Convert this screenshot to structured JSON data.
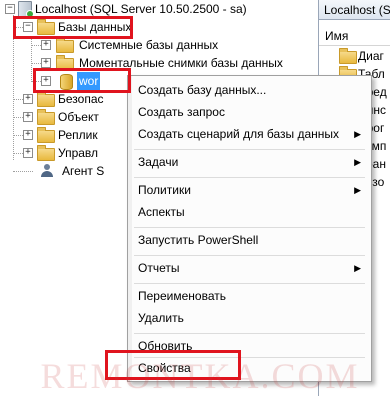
{
  "tree": {
    "server": "Localhost (SQL Server 10.50.2500 - sa)",
    "databases": "Базы данных",
    "system_databases": "Системные базы данных",
    "snapshots": "Моментальные снимки базы данных",
    "selected_db": "wor",
    "security": "Безопас",
    "server_objects": "Объект",
    "replication": "Реплик",
    "management": "Управл",
    "agent": "Агент S"
  },
  "right_panel": {
    "tab": "Localhost (SQL",
    "column_header": "Имя",
    "rows": [
      "Диаг",
      "Табл",
      "Пред",
      "Синс",
      "Прог",
      "Комп",
      "Хран",
      "Безо"
    ]
  },
  "context_menu": {
    "items": [
      "Создать базу данных...",
      "Создать запрос",
      "Создать сценарий для базы данных",
      "Задачи",
      "Политики",
      "Аспекты",
      "Запустить PowerShell",
      "Отчеты",
      "Переименовать",
      "Удалить",
      "Обновить",
      "Свойства"
    ],
    "submenu_arrow": "▶"
  },
  "watermark": "REMONTKA.COM",
  "colors": {
    "highlight": "#e0141e",
    "selection": "#3399ff"
  }
}
